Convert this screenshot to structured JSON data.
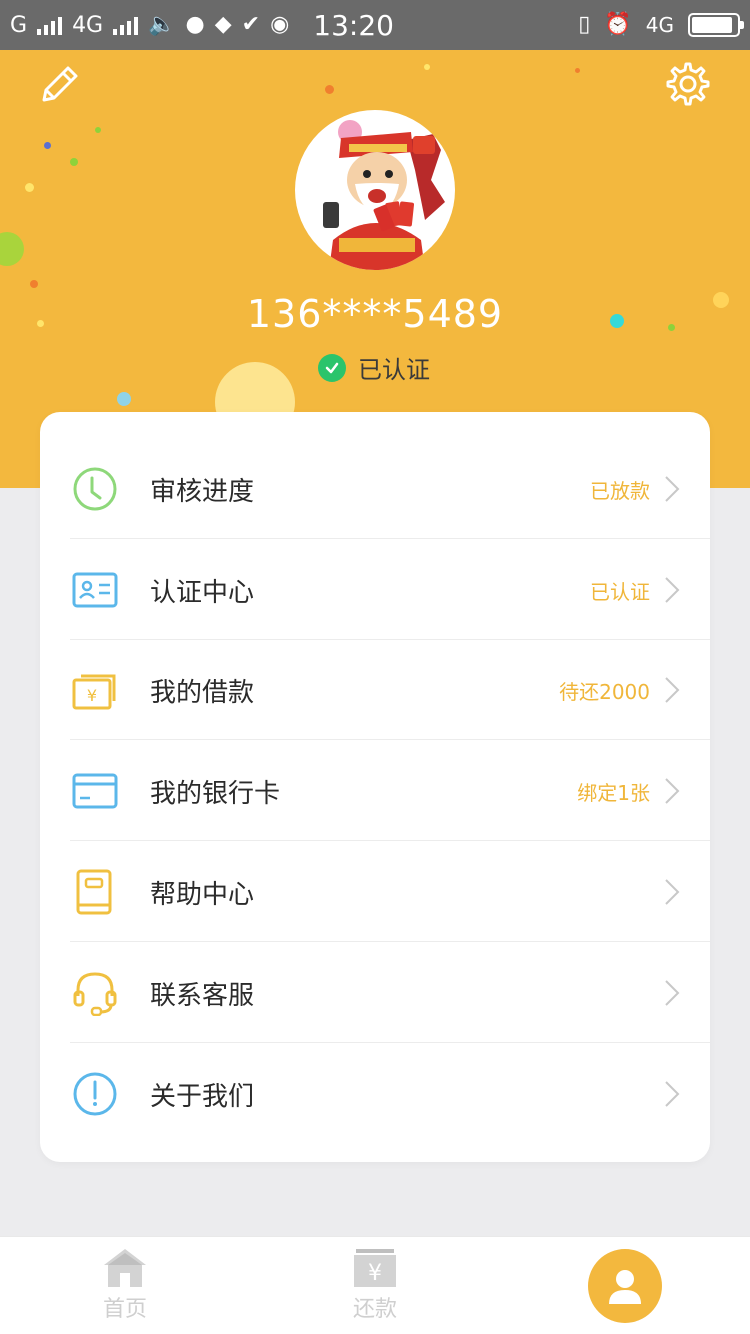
{
  "status_bar": {
    "carrier1": "G",
    "carrier2": "4G",
    "time": "13:20",
    "network": "4G"
  },
  "profile": {
    "phone": "136****5489",
    "verified_label": "已认证"
  },
  "menu": [
    {
      "label": "审核进度",
      "status": "已放款",
      "icon": "clock-icon"
    },
    {
      "label": "认证中心",
      "status": "已认证",
      "icon": "id-card-icon"
    },
    {
      "label": "我的借款",
      "status": "待还2000",
      "icon": "money-bill-icon"
    },
    {
      "label": "我的银行卡",
      "status": "绑定1张",
      "icon": "bank-card-icon"
    },
    {
      "label": "帮助中心",
      "status": "",
      "icon": "book-icon"
    },
    {
      "label": "联系客服",
      "status": "",
      "icon": "headset-icon"
    },
    {
      "label": "关于我们",
      "status": "",
      "icon": "info-icon"
    }
  ],
  "tabs": {
    "home": "首页",
    "repay": "还款"
  },
  "colors": {
    "brand": "#f3b83e",
    "status_text": "#f0b63a",
    "verified_green": "#2bc46b"
  }
}
